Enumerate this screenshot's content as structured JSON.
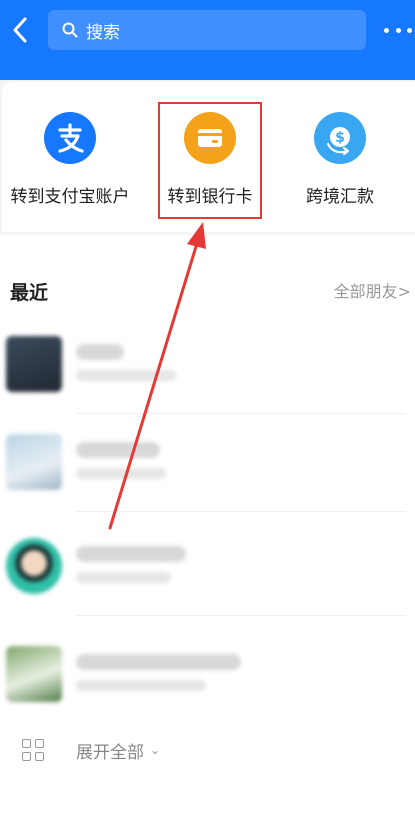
{
  "header": {
    "search_label": "搜索"
  },
  "actions": [
    {
      "label": "转到支付宝账户",
      "icon": "alipay-icon",
      "color": "#1677ff"
    },
    {
      "label": "转到银行卡",
      "icon": "bank-card-icon",
      "color": "#f5a21b"
    },
    {
      "label": "跨境汇款",
      "icon": "cross-border-remittance-icon",
      "color": "#39a6f2"
    }
  ],
  "recent": {
    "title": "最近",
    "all_friends": "全部朋友",
    "all_friends_chevron": ">"
  },
  "footer": {
    "expand_label": "展开全部",
    "expand_chevron": "⌄"
  },
  "colors": {
    "header_bg": "#1677ff",
    "highlight": "#e53935"
  }
}
